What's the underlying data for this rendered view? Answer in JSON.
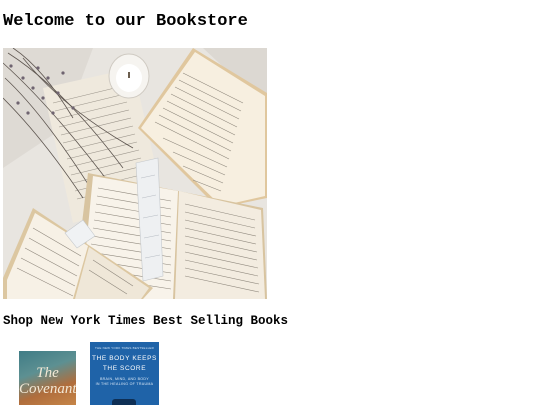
{
  "page": {
    "title": "Welcome to our Bookstore",
    "section_title": "Shop New York Times Best Selling Books"
  },
  "books": [
    {
      "cover_title": "The Covenant",
      "colors": {
        "primary": "#5d9092",
        "secondary": "#b06d3c"
      }
    },
    {
      "cover_top": "THE NEW YORK TIMES BESTSELLER",
      "cover_title_line1": "THE BODY KEEPS",
      "cover_title_line2": "THE SCORE",
      "cover_sub_line1": "BRAIN, MIND, AND BODY",
      "cover_sub_line2": "IN THE HEALING OF TRAUMA",
      "colors": {
        "primary": "#1f63a8"
      }
    }
  ]
}
